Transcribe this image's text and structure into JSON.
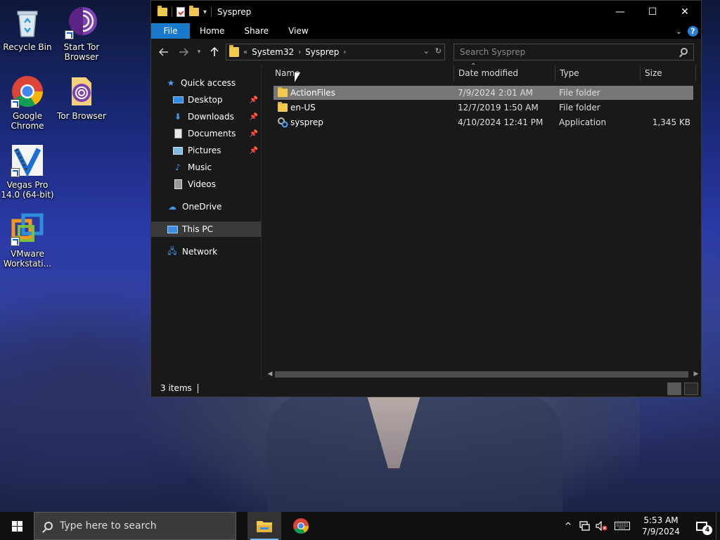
{
  "desktop": {
    "icons": [
      {
        "label": "Recycle Bin"
      },
      {
        "label": "Start Tor Browser"
      },
      {
        "label": "Google Chrome"
      },
      {
        "label": "Tor Browser"
      },
      {
        "label": "Vegas Pro 14.0 (64-bit)"
      },
      {
        "label": "VMware Workstati..."
      }
    ]
  },
  "window": {
    "title": "Sysprep",
    "controls": {
      "minimize": "—",
      "maximize": "☐",
      "close": "✕"
    },
    "ribbon_tabs": [
      "File",
      "Home",
      "Share",
      "View"
    ],
    "address": {
      "overflow": "«",
      "crumbs": [
        "System32",
        "Sysprep"
      ]
    },
    "search_placeholder": "Search Sysprep",
    "nav_pane": {
      "quick_access": "Quick access",
      "items": [
        "Desktop",
        "Downloads",
        "Documents",
        "Pictures",
        "Music",
        "Videos"
      ],
      "onedrive": "OneDrive",
      "this_pc": "This PC",
      "network": "Network"
    },
    "columns": {
      "name": "Name",
      "date": "Date modified",
      "type": "Type",
      "size": "Size"
    },
    "files": [
      {
        "name": "ActionFiles",
        "date": "7/9/2024 2:01 AM",
        "type": "File folder",
        "size": "",
        "icon": "folder-icon",
        "selected": true
      },
      {
        "name": "en-US",
        "date": "12/7/2019 1:50 AM",
        "type": "File folder",
        "size": "",
        "icon": "folder-icon",
        "selected": false
      },
      {
        "name": "sysprep",
        "date": "4/10/2024 12:41 PM",
        "type": "Application",
        "size": "1,345 KB",
        "icon": "application-icon",
        "selected": false
      }
    ],
    "status": {
      "item_count": "3 items"
    }
  },
  "taskbar": {
    "search_placeholder": "Type here to search",
    "clock": {
      "time": "5:53 AM",
      "date": "7/9/2024"
    },
    "notification_count": "4"
  },
  "colors": {
    "file_tab": "#1979ca",
    "window_bg": "#191919",
    "selection": "#777777",
    "taskbar": "#101010"
  }
}
